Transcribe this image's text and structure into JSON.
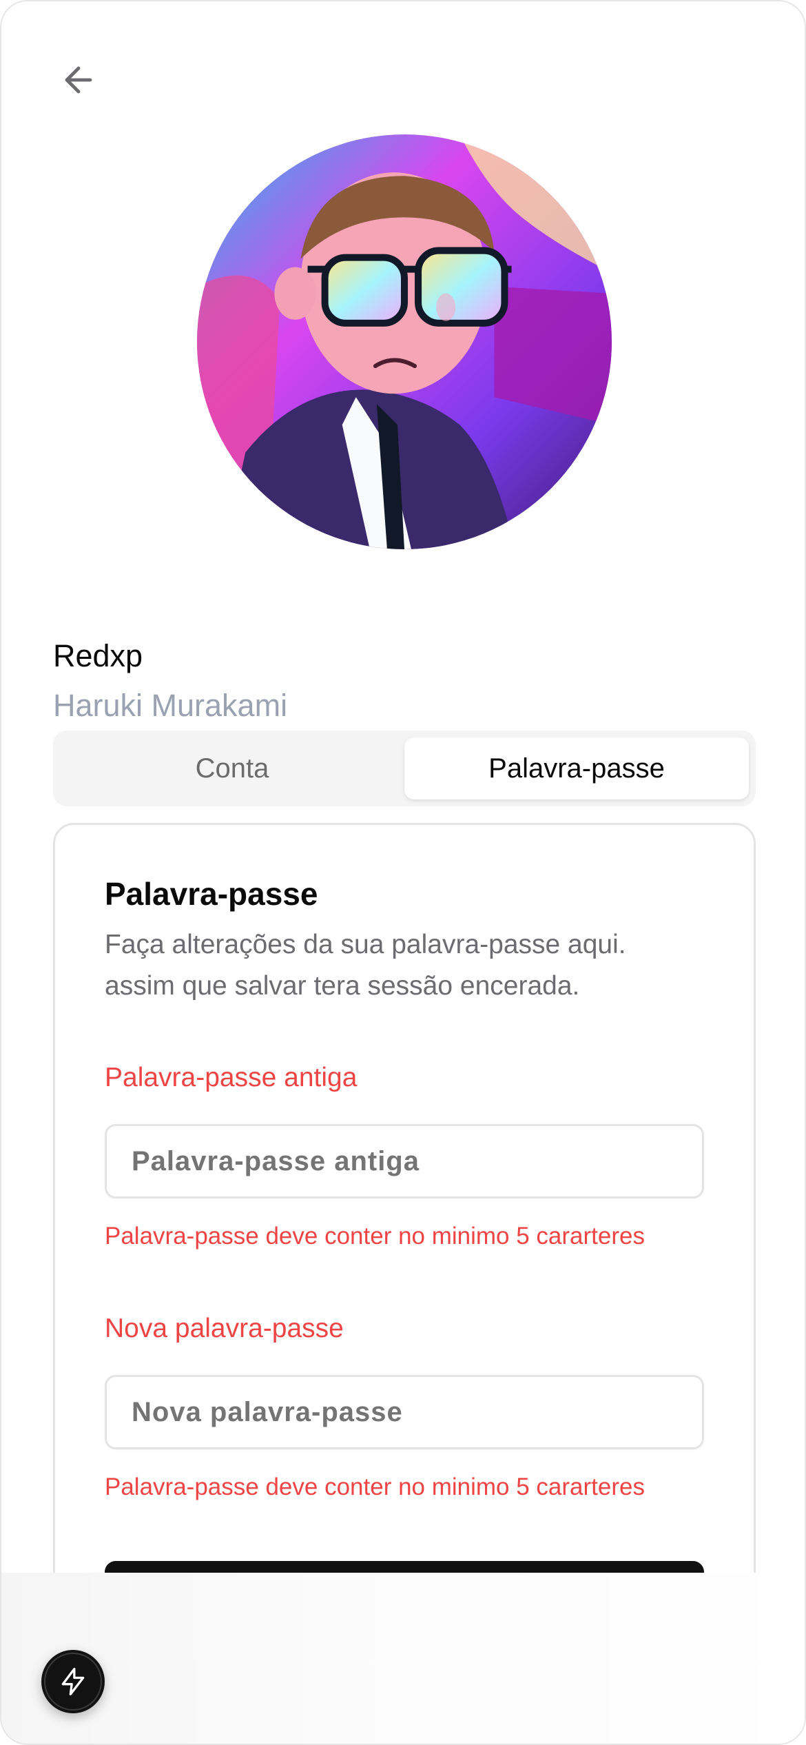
{
  "header": {
    "back_icon": "arrow-left-icon"
  },
  "profile": {
    "name": "Redxp",
    "username": "Haruki Murakami"
  },
  "tabs": [
    {
      "label": "Conta",
      "active": false
    },
    {
      "label": "Palavra-passe",
      "active": true
    }
  ],
  "password_card": {
    "title": "Palavra-passe",
    "description": "Faça alterações da sua palavra-passe aqui. assim que salvar tera sessão encerada.",
    "fields": [
      {
        "label": "Palavra-passe antiga",
        "placeholder": "Palavra-passe antiga",
        "error": "Palavra-passe deve conter no minimo 5 cararteres"
      },
      {
        "label": "Nova palavra-passe",
        "placeholder": "Nova palavra-passe",
        "error": "Palavra-passe deve conter no minimo 5 cararteres"
      }
    ]
  },
  "fab": {
    "icon": "lightning-bolt-icon"
  },
  "colors": {
    "error": "#ef4444",
    "muted": "#9aa1b0",
    "primary": "#111111"
  }
}
